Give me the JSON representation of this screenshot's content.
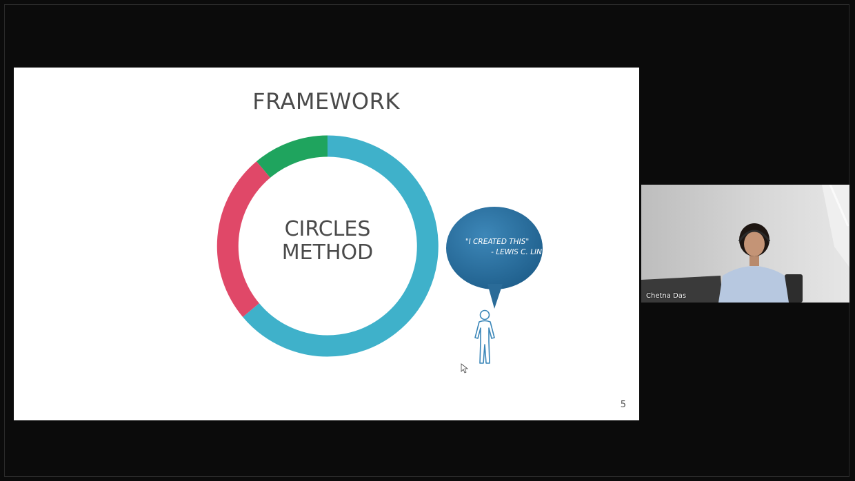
{
  "slide": {
    "title": "FRAMEWORK",
    "center_line1": "CIRCLES",
    "center_line2": "METHOD",
    "quote_line1": "\"I CREATED THIS\"",
    "quote_line2": "- LEWIS C. LIN",
    "page_number": "5",
    "ring_colors": [
      "#3fb1ca",
      "#e04868",
      "#1fa45e"
    ],
    "bubble_color": "#2b6f9e"
  },
  "participant": {
    "name": "Chetna Das"
  }
}
